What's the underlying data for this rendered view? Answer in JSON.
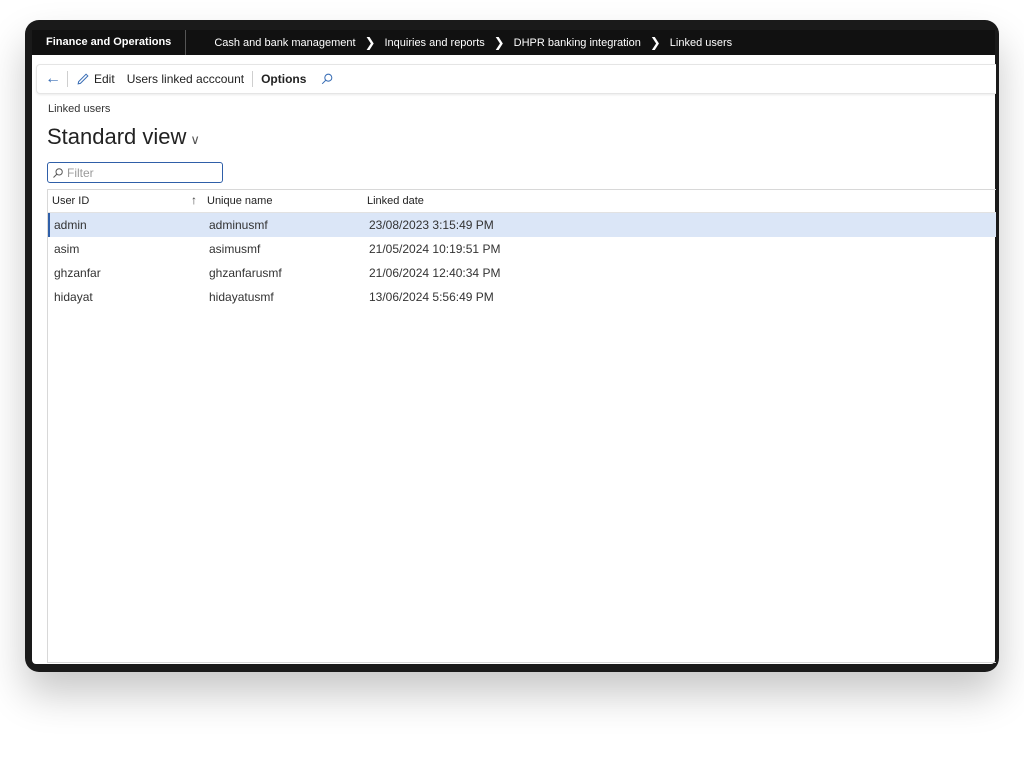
{
  "topbar": {
    "brand": "Finance and Operations",
    "breadcrumbs": [
      "Cash and bank management",
      "Inquiries and reports",
      "DHPR banking integration",
      "Linked users"
    ]
  },
  "actionbar": {
    "edit_label": "Edit",
    "users_linked_label": "Users linked acccount",
    "options_label": "Options"
  },
  "page": {
    "caption": "Linked users",
    "view_title": "Standard view"
  },
  "filter": {
    "placeholder": "Filter"
  },
  "grid": {
    "columns": [
      "User ID",
      "Unique name",
      "Linked date"
    ],
    "rows": [
      {
        "user_id": "admin",
        "unique_name": "adminusmf",
        "linked_date": "23/08/2023 3:15:49 PM"
      },
      {
        "user_id": "asim",
        "unique_name": "asimusmf",
        "linked_date": "21/05/2024 10:19:51 PM"
      },
      {
        "user_id": "ghzanfar",
        "unique_name": "ghzanfarusmf",
        "linked_date": "21/06/2024 12:40:34 PM"
      },
      {
        "user_id": "hidayat",
        "unique_name": "hidayatusmf",
        "linked_date": "13/06/2024 5:56:49 PM"
      }
    ]
  },
  "colors": {
    "accent": "#2f5fa8",
    "selected_row": "#dbe6f7",
    "topbar": "#111111"
  },
  "icons": [
    "back-arrow-icon",
    "pencil-icon",
    "search-icon",
    "chevron-right-icon",
    "chevron-down-icon",
    "sort-up-icon"
  ]
}
